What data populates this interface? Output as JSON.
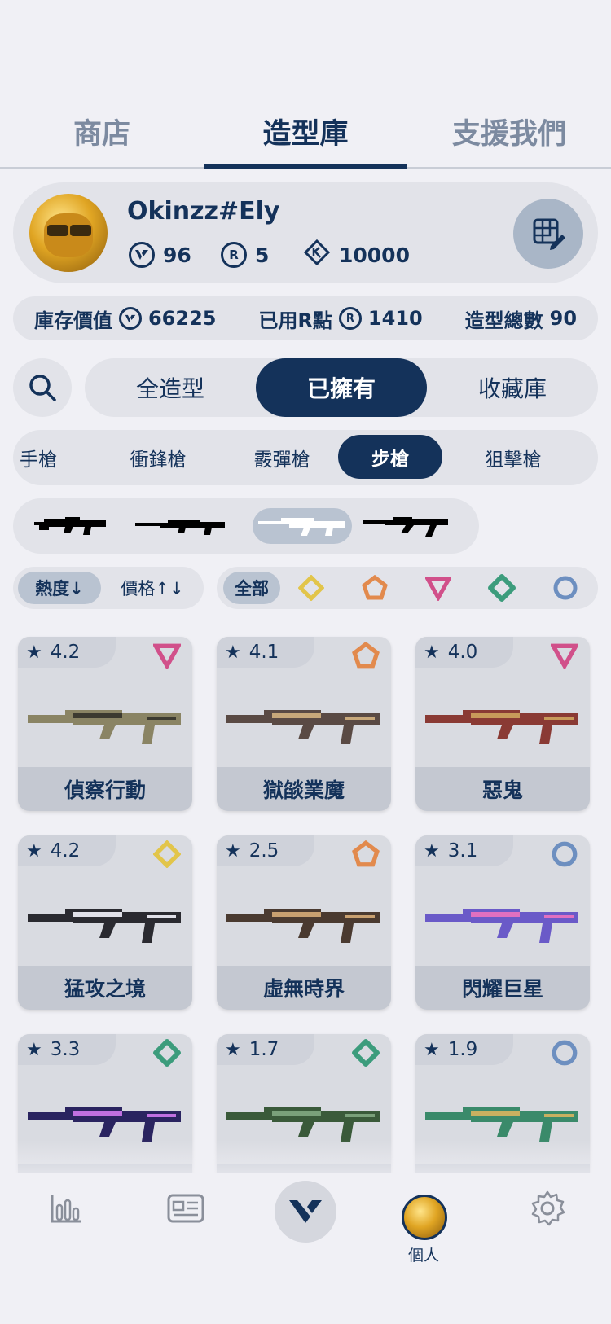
{
  "top_tabs": {
    "shop": "商店",
    "library": "造型庫",
    "support": "支援我們"
  },
  "profile": {
    "username": "Okinzz#Ely",
    "vp": "96",
    "rp": "5",
    "kingdom": "10000"
  },
  "values": {
    "inventory_label": "庫存價值",
    "inventory_value": "66225",
    "rp_used_label": "已用R點",
    "rp_used_value": "1410",
    "skins_label": "造型總數",
    "skins_value": "90"
  },
  "ownership": {
    "all": "全造型",
    "owned": "已擁有",
    "collection": "收藏庫",
    "selected": "已擁有"
  },
  "categories": [
    "手槍",
    "衝鋒槍",
    "霰彈槍",
    "步槍",
    "狙擊槍"
  ],
  "selected_category": "步槍",
  "sort": {
    "popularity": "熱度↓",
    "price": "價格↑↓"
  },
  "rarity": {
    "all": "全部"
  },
  "colors": {
    "navy": "#14325a",
    "select": "#e2c54a",
    "deluxe": "#e28a4d",
    "premium": "#d1508a",
    "exclusive": "#3c9c7c",
    "ultra": "#6d8fc0"
  },
  "cards": [
    {
      "rating": "4.2",
      "name": "偵察行動",
      "tier": "premium"
    },
    {
      "rating": "4.1",
      "name": "獄燄業魔",
      "tier": "deluxe"
    },
    {
      "rating": "4.0",
      "name": "惡鬼",
      "tier": "premium"
    },
    {
      "rating": "4.2",
      "name": "猛攻之境",
      "tier": "select"
    },
    {
      "rating": "2.5",
      "name": "虛無時界",
      "tier": "deluxe"
    },
    {
      "rating": "3.1",
      "name": "閃耀巨星",
      "tier": "ultra"
    },
    {
      "rating": "3.3",
      "name": "",
      "tier": "exclusive"
    },
    {
      "rating": "1.7",
      "name": "",
      "tier": "exclusive"
    },
    {
      "rating": "1.9",
      "name": "",
      "tier": "ultra"
    }
  ],
  "nav": {
    "profile_label": "個人"
  }
}
